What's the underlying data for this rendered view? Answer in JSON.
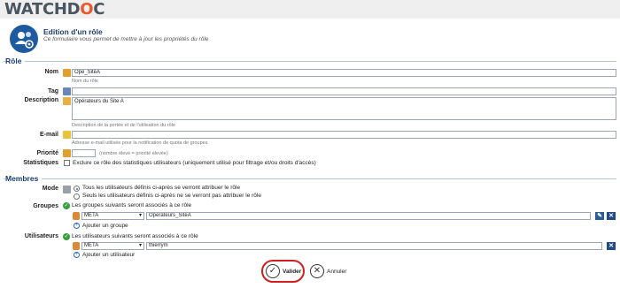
{
  "brand": {
    "logo_prefix": "WATCHD",
    "logo_mid": "O",
    "logo_suffix": "C"
  },
  "header": {
    "title": "Edition d'un rôle",
    "subtitle": "Ce formulaire vous permet de mettre à jour les propriétés du rôle",
    "icon": "people-settings-icon"
  },
  "role_section": {
    "legend": "Rôle",
    "name": {
      "label": "Nom",
      "value": "Ope_SiteA",
      "hint": "Nom du rôle"
    },
    "tag": {
      "label": "Tag",
      "value": ""
    },
    "description": {
      "label": "Description",
      "value": "Opérateurs du Site A",
      "hint": "Description de la portée et de l'utilisation du rôle"
    },
    "email": {
      "label": "E-mail",
      "value": "",
      "hint": "Adresse e-mail utilisée pour la notification de quota de groupes"
    },
    "priority": {
      "label": "Priorité",
      "value": "",
      "hint": "(nombre élevé = priorité élevée)"
    },
    "statistics": {
      "label": "Statistiques",
      "checkbox_label": "Exclure ce rôle des statistiques utilisateurs (uniquement utilisé pour filtrage et/ou droits d'accès)",
      "checked": false
    }
  },
  "members_section": {
    "legend": "Membres",
    "mode": {
      "label": "Mode",
      "options": [
        "Tous les utilisateurs définis ci-après se verront attribuer le rôle",
        "Seuls les utilisateurs définis ci-après ne se verront pas attribuer le rôle"
      ],
      "selected": 0
    },
    "groups": {
      "label": "Groupes",
      "description": "Les groupes suivants seront associés à ce rôle",
      "domain": "META",
      "value": "Operateurs_SiteA",
      "add_label": "Ajouter un groupe"
    },
    "users": {
      "label": "Utilisateurs",
      "description": "Les utilisateurs suivants seront associés à ce rôle",
      "domain": "META",
      "value": "thierrym",
      "add_label": "Ajouter un utilisateur"
    }
  },
  "actions": {
    "validate_label": "Valider",
    "cancel_label": "Annuler"
  },
  "colors": {
    "accent": "#1b3d6e",
    "brand_orange": "#e85a2a",
    "highlight": "#d21e1e",
    "green": "#35a03a"
  }
}
